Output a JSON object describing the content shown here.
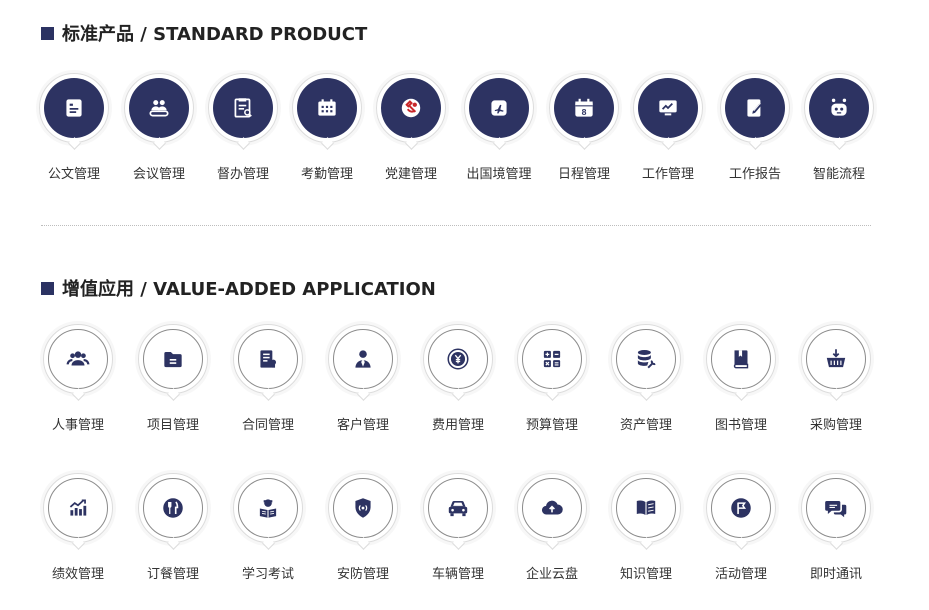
{
  "standard": {
    "title": "标准产品 / STANDARD PRODUCT",
    "items": [
      {
        "label": "公文管理",
        "icon": "document-icon"
      },
      {
        "label": "会议管理",
        "icon": "meeting-icon"
      },
      {
        "label": "督办管理",
        "icon": "supervise-icon"
      },
      {
        "label": "考勤管理",
        "icon": "attendance-icon"
      },
      {
        "label": "党建管理",
        "icon": "party-emblem-icon"
      },
      {
        "label": "出国境管理",
        "icon": "airplane-icon"
      },
      {
        "label": "日程管理",
        "icon": "calendar-icon"
      },
      {
        "label": "工作管理",
        "icon": "chart-monitor-icon"
      },
      {
        "label": "工作报告",
        "icon": "report-edit-icon"
      },
      {
        "label": "智能流程",
        "icon": "robot-icon"
      }
    ]
  },
  "added": {
    "title": "增值应用 / VALUE-ADDED APPLICATION",
    "row1": [
      {
        "label": "人事管理",
        "icon": "people-icon"
      },
      {
        "label": "项目管理",
        "icon": "folder-icon"
      },
      {
        "label": "合同管理",
        "icon": "contract-icon"
      },
      {
        "label": "客户管理",
        "icon": "customer-icon"
      },
      {
        "label": "费用管理",
        "icon": "yen-coin-icon"
      },
      {
        "label": "预算管理",
        "icon": "calculator-icon"
      },
      {
        "label": "资产管理",
        "icon": "database-wrench-icon"
      },
      {
        "label": "图书管理",
        "icon": "book-icon"
      },
      {
        "label": "采购管理",
        "icon": "basket-icon"
      }
    ],
    "row2": [
      {
        "label": "绩效管理",
        "icon": "performance-chart-icon"
      },
      {
        "label": "订餐管理",
        "icon": "fork-knife-icon"
      },
      {
        "label": "学习考试",
        "icon": "study-icon"
      },
      {
        "label": "安防管理",
        "icon": "shield-icon"
      },
      {
        "label": "车辆管理",
        "icon": "car-icon"
      },
      {
        "label": "企业云盘",
        "icon": "cloud-upload-icon"
      },
      {
        "label": "知识管理",
        "icon": "open-book-icon"
      },
      {
        "label": "活动管理",
        "icon": "flag-icon"
      },
      {
        "label": "即时通讯",
        "icon": "chat-icon"
      }
    ]
  }
}
